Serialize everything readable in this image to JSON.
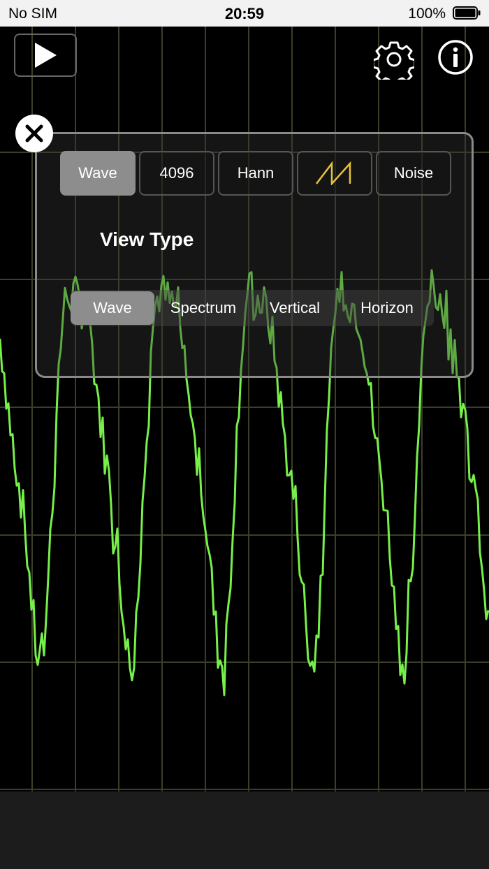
{
  "status_bar": {
    "carrier": "No SIM",
    "time": "20:59",
    "battery": "100%"
  },
  "toolbar": {
    "play_icon": "play-icon",
    "settings_icon": "gear-icon",
    "info_icon": "info-icon"
  },
  "panel": {
    "close_icon": "close-icon",
    "options": [
      {
        "label": "Wave",
        "active": true
      },
      {
        "label": "4096",
        "active": false
      },
      {
        "label": "Hann",
        "active": false
      },
      {
        "label": "",
        "icon": "sawtooth-icon",
        "active": false
      },
      {
        "label": "Noise",
        "active": false
      }
    ],
    "view_type_title": "View Type",
    "view_types": [
      {
        "label": "Wave",
        "active": true
      },
      {
        "label": "Spectrum",
        "active": false
      },
      {
        "label": "Vertical",
        "active": false
      },
      {
        "label": "Horizon",
        "active": false
      }
    ]
  },
  "colors": {
    "trace": "#77f04a",
    "grid": "#3b3f28",
    "sawtooth": "#e8c23a",
    "selected": "#8d8d8d"
  }
}
